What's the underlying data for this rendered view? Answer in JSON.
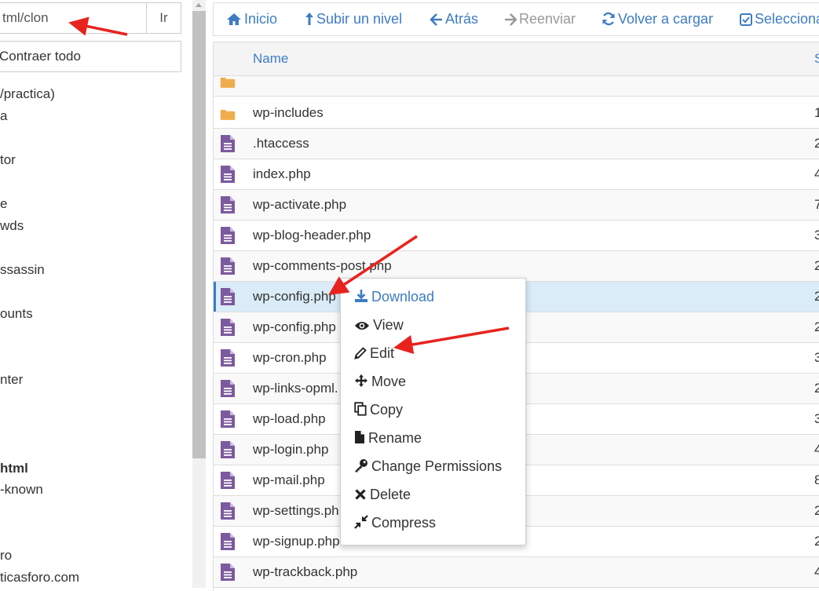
{
  "sidebar": {
    "path_value": "tml/clon",
    "go_label": "Ir",
    "collapse_label": "Contraer todo",
    "tree": [
      {
        "label": "/practica)",
        "bold": false
      },
      {
        "label": "a",
        "bold": false
      },
      {
        "label": "tor",
        "bold": false
      },
      {
        "label": "e",
        "bold": false
      },
      {
        "label": "wds",
        "bold": false
      },
      {
        "label": "ssassin",
        "bold": false
      },
      {
        "label": "ounts",
        "bold": false
      },
      {
        "label": "nter",
        "bold": false
      },
      {
        "label": "html",
        "bold": true
      },
      {
        "label": "-known",
        "bold": false
      },
      {
        "label": "ro",
        "bold": false
      },
      {
        "label": "ticasforo.com",
        "bold": false
      }
    ]
  },
  "toolbar": {
    "home_label": "Inicio",
    "up_label": "Subir un nivel",
    "back_label": "Atrás",
    "forward_label": "Reenviar",
    "reload_label": "Volver a cargar",
    "select_label": "Selecciona"
  },
  "table": {
    "col_name": "Name",
    "col_size": "S",
    "rows": [
      {
        "name": "wp-includes",
        "size": "1",
        "type": "folder"
      },
      {
        "name": ".htaccess",
        "size": "2",
        "type": "file"
      },
      {
        "name": "index.php",
        "size": "4",
        "type": "file"
      },
      {
        "name": "wp-activate.php",
        "size": "7",
        "type": "file"
      },
      {
        "name": "wp-blog-header.php",
        "size": "3",
        "type": "file"
      },
      {
        "name": "wp-comments-post.php",
        "size": "2",
        "type": "file"
      },
      {
        "name": "wp-config.php",
        "size": "2",
        "type": "file",
        "selected": true
      },
      {
        "name": "wp-config.php",
        "size": "2",
        "type": "file"
      },
      {
        "name": "wp-cron.php",
        "size": "3",
        "type": "file"
      },
      {
        "name": "wp-links-opml.",
        "size": "2",
        "type": "file"
      },
      {
        "name": "wp-load.php",
        "size": "3",
        "type": "file"
      },
      {
        "name": "wp-login.php",
        "size": "4",
        "type": "file"
      },
      {
        "name": "wp-mail.php",
        "size": "8",
        "type": "file"
      },
      {
        "name": "wp-settings.ph",
        "size": "2",
        "type": "file"
      },
      {
        "name": "wp-signup.php",
        "size": "2",
        "type": "file"
      },
      {
        "name": "wp-trackback.php",
        "size": "4",
        "type": "file"
      }
    ]
  },
  "context_menu": {
    "items": [
      {
        "label": "Download",
        "icon": "download-icon"
      },
      {
        "label": "View",
        "icon": "eye-icon"
      },
      {
        "label": "Edit",
        "icon": "pencil-icon"
      },
      {
        "label": "Move",
        "icon": "move-icon"
      },
      {
        "label": "Copy",
        "icon": "copy-icon"
      },
      {
        "label": "Rename",
        "icon": "file-icon"
      },
      {
        "label": "Change Permissions",
        "icon": "key-icon"
      },
      {
        "label": "Delete",
        "icon": "close-icon"
      },
      {
        "label": "Compress",
        "icon": "compress-icon"
      }
    ]
  },
  "colors": {
    "accent_blue": "#3d7cc4",
    "file_icon_purple": "#7c5a9e",
    "folder_orange": "#f0ad4e",
    "selected_row": "#d9ecf7",
    "annotation_red": "#e8231e"
  }
}
